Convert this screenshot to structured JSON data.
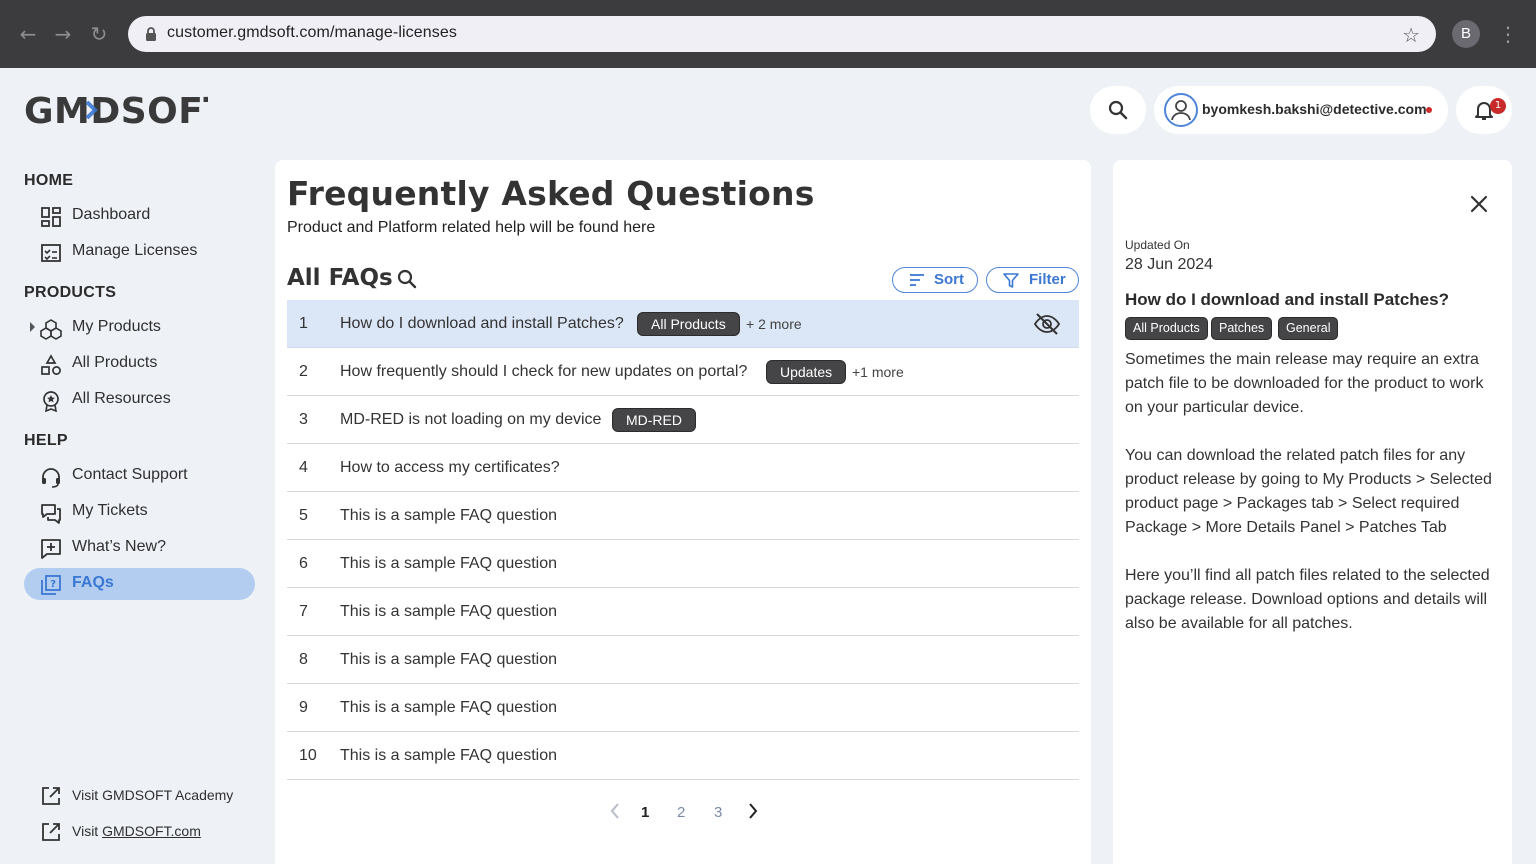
{
  "browser": {
    "url": "customer.gmdsoft.com/manage-licenses",
    "profile_initial": "B"
  },
  "header": {
    "logo_text": "GMDSOFT",
    "user_email": "byomkesh.bakshi@detective.com",
    "notification_count": "1"
  },
  "sidebar": {
    "sections": {
      "home": "HOME",
      "products": "PRODUCTS",
      "help": "HELP"
    },
    "items": {
      "dashboard": "Dashboard",
      "manage_licenses": "Manage Licenses",
      "my_products": "My Products",
      "all_products": "All Products",
      "all_resources": "All Resources",
      "contact_support": "Contact Support",
      "my_tickets": "My Tickets",
      "whats_new": "What’s New?",
      "faqs": "FAQs"
    },
    "external": {
      "academy": "Visit GMDSOFT Academy",
      "site_prefix": "Visit ",
      "site_link": "GMDSOFT.com"
    },
    "active_item": "faqs"
  },
  "main": {
    "title": "Frequently Asked Questions",
    "subtitle": "Product and Platform related help will be found here",
    "list_title": "All FAQs",
    "sort_label": "Sort",
    "filter_label": "Filter",
    "faqs": [
      {
        "num": "1",
        "question": "How do I download and install Patches?",
        "tag": "All Products",
        "more": "+ 2 more",
        "selected": true
      },
      {
        "num": "2",
        "question": "How frequently should I check for new updates on portal?",
        "tag": "Updates",
        "more": "+1 more"
      },
      {
        "num": "3",
        "question": "MD-RED is not loading on my device",
        "tag": "MD-RED",
        "more": ""
      },
      {
        "num": "4",
        "question": "How to access my certificates?",
        "tag": "",
        "more": ""
      },
      {
        "num": "5",
        "question": "This is a sample FAQ question",
        "tag": "",
        "more": ""
      },
      {
        "num": "6",
        "question": "This is a sample FAQ question",
        "tag": "",
        "more": ""
      },
      {
        "num": "7",
        "question": "This is a sample FAQ question",
        "tag": "",
        "more": ""
      },
      {
        "num": "8",
        "question": "This is a sample FAQ question",
        "tag": "",
        "more": ""
      },
      {
        "num": "9",
        "question": "This is a sample FAQ question",
        "tag": "",
        "more": ""
      },
      {
        "num": "10",
        "question": "This is a sample FAQ question",
        "tag": "",
        "more": ""
      }
    ],
    "pagination": {
      "pages": [
        "1",
        "2",
        "3"
      ],
      "current": "1"
    }
  },
  "detail": {
    "updated_label": "Updated On",
    "updated_value": "28 Jun 2024",
    "question": "How do I download and install Patches?",
    "tags": [
      "All Products",
      "Patches",
      "General"
    ],
    "paragraphs": [
      "Sometimes the main release may require an extra patch file to be downloaded for the product to work on your particular device.",
      "You can download the related patch files for any product release by going to My Products > Selected product page > Packages tab > Select required Package > More Details Panel > Patches Tab",
      "Here you’ll find all patch files related to the selected package release. Download options and details will also be available for all patches."
    ]
  },
  "colors": {
    "accent": "#3b78d3",
    "selected_row": "#dbe6f6",
    "active_nav": "#b3cdf0",
    "tag_bg": "#454547",
    "badge": "#c82a2a"
  }
}
